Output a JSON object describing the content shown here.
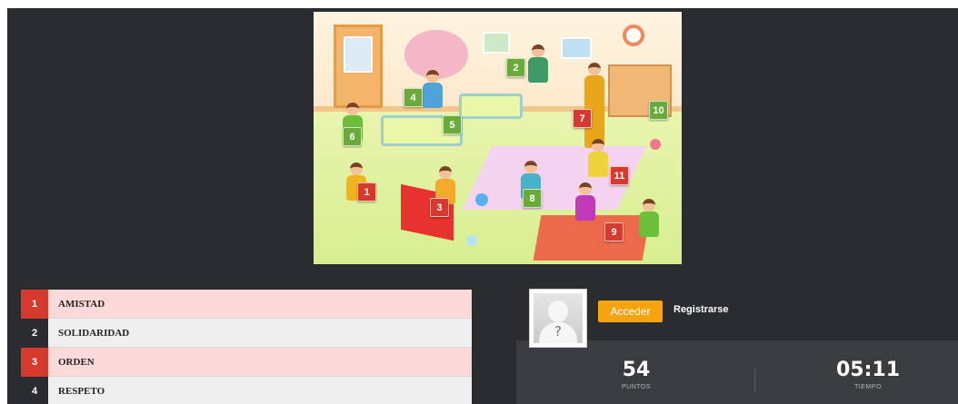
{
  "scene": {
    "markers": [
      {
        "number": "1",
        "color": "red"
      },
      {
        "number": "2",
        "color": "green"
      },
      {
        "number": "3",
        "color": "red"
      },
      {
        "number": "4",
        "color": "green"
      },
      {
        "number": "5",
        "color": "green"
      },
      {
        "number": "6",
        "color": "green"
      },
      {
        "number": "7",
        "color": "red"
      },
      {
        "number": "8",
        "color": "green"
      },
      {
        "number": "9",
        "color": "red"
      },
      {
        "number": "10",
        "color": "green"
      },
      {
        "number": "11",
        "color": "red"
      }
    ]
  },
  "word_list": [
    {
      "number": "1",
      "word": "AMISTAD",
      "state": "found"
    },
    {
      "number": "2",
      "word": "SOLIDARIDAD",
      "state": "pending"
    },
    {
      "number": "3",
      "word": "ORDEN",
      "state": "found"
    },
    {
      "number": "4",
      "word": "RESPETO",
      "state": "pending"
    }
  ],
  "user": {
    "avatar_symbol": "?",
    "login_label": "Acceder",
    "register_label": "Registrarse"
  },
  "stats": {
    "points_value": "54",
    "points_label": "PUNTOS",
    "time_value": "05:11",
    "time_label": "TIEMPO"
  },
  "colors": {
    "background": "#2a2c2f",
    "found_red": "#d63a2e",
    "marker_green": "#6aaa3a",
    "login_orange": "#f5a40f"
  }
}
